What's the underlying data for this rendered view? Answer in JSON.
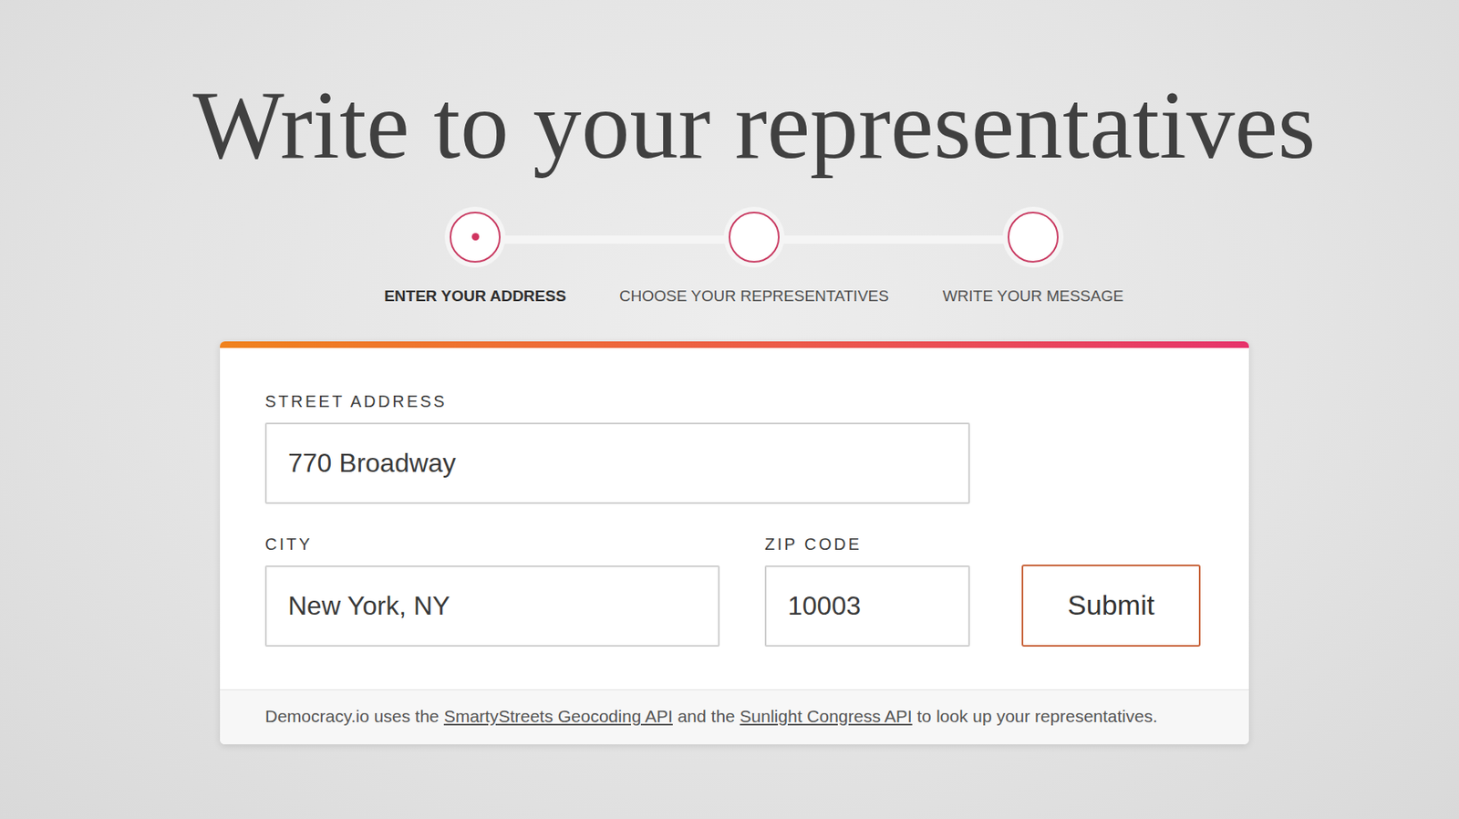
{
  "page": {
    "title": "Write to your representatives"
  },
  "steps": [
    {
      "label": "ENTER YOUR ADDRESS",
      "selected": true
    },
    {
      "label": "CHOOSE YOUR REPRESENTATIVES",
      "selected": false
    },
    {
      "label": "WRITE YOUR MESSAGE",
      "selected": false
    }
  ],
  "form": {
    "street": {
      "label": "STREET ADDRESS",
      "value": "770 Broadway"
    },
    "city": {
      "label": "CITY",
      "value": "New York, NY"
    },
    "zip": {
      "label": "ZIP CODE",
      "value": "10003"
    },
    "submit": "Submit"
  },
  "footer": [
    {
      "text": "Democracy.io uses the ",
      "link": false
    },
    {
      "text": "SmartyStreets Geocoding API",
      "link": true
    },
    {
      "text": " and the ",
      "link": false
    },
    {
      "text": "Sunlight Congress API",
      "link": true
    },
    {
      "text": " to look up your representatives.",
      "link": false
    }
  ]
}
